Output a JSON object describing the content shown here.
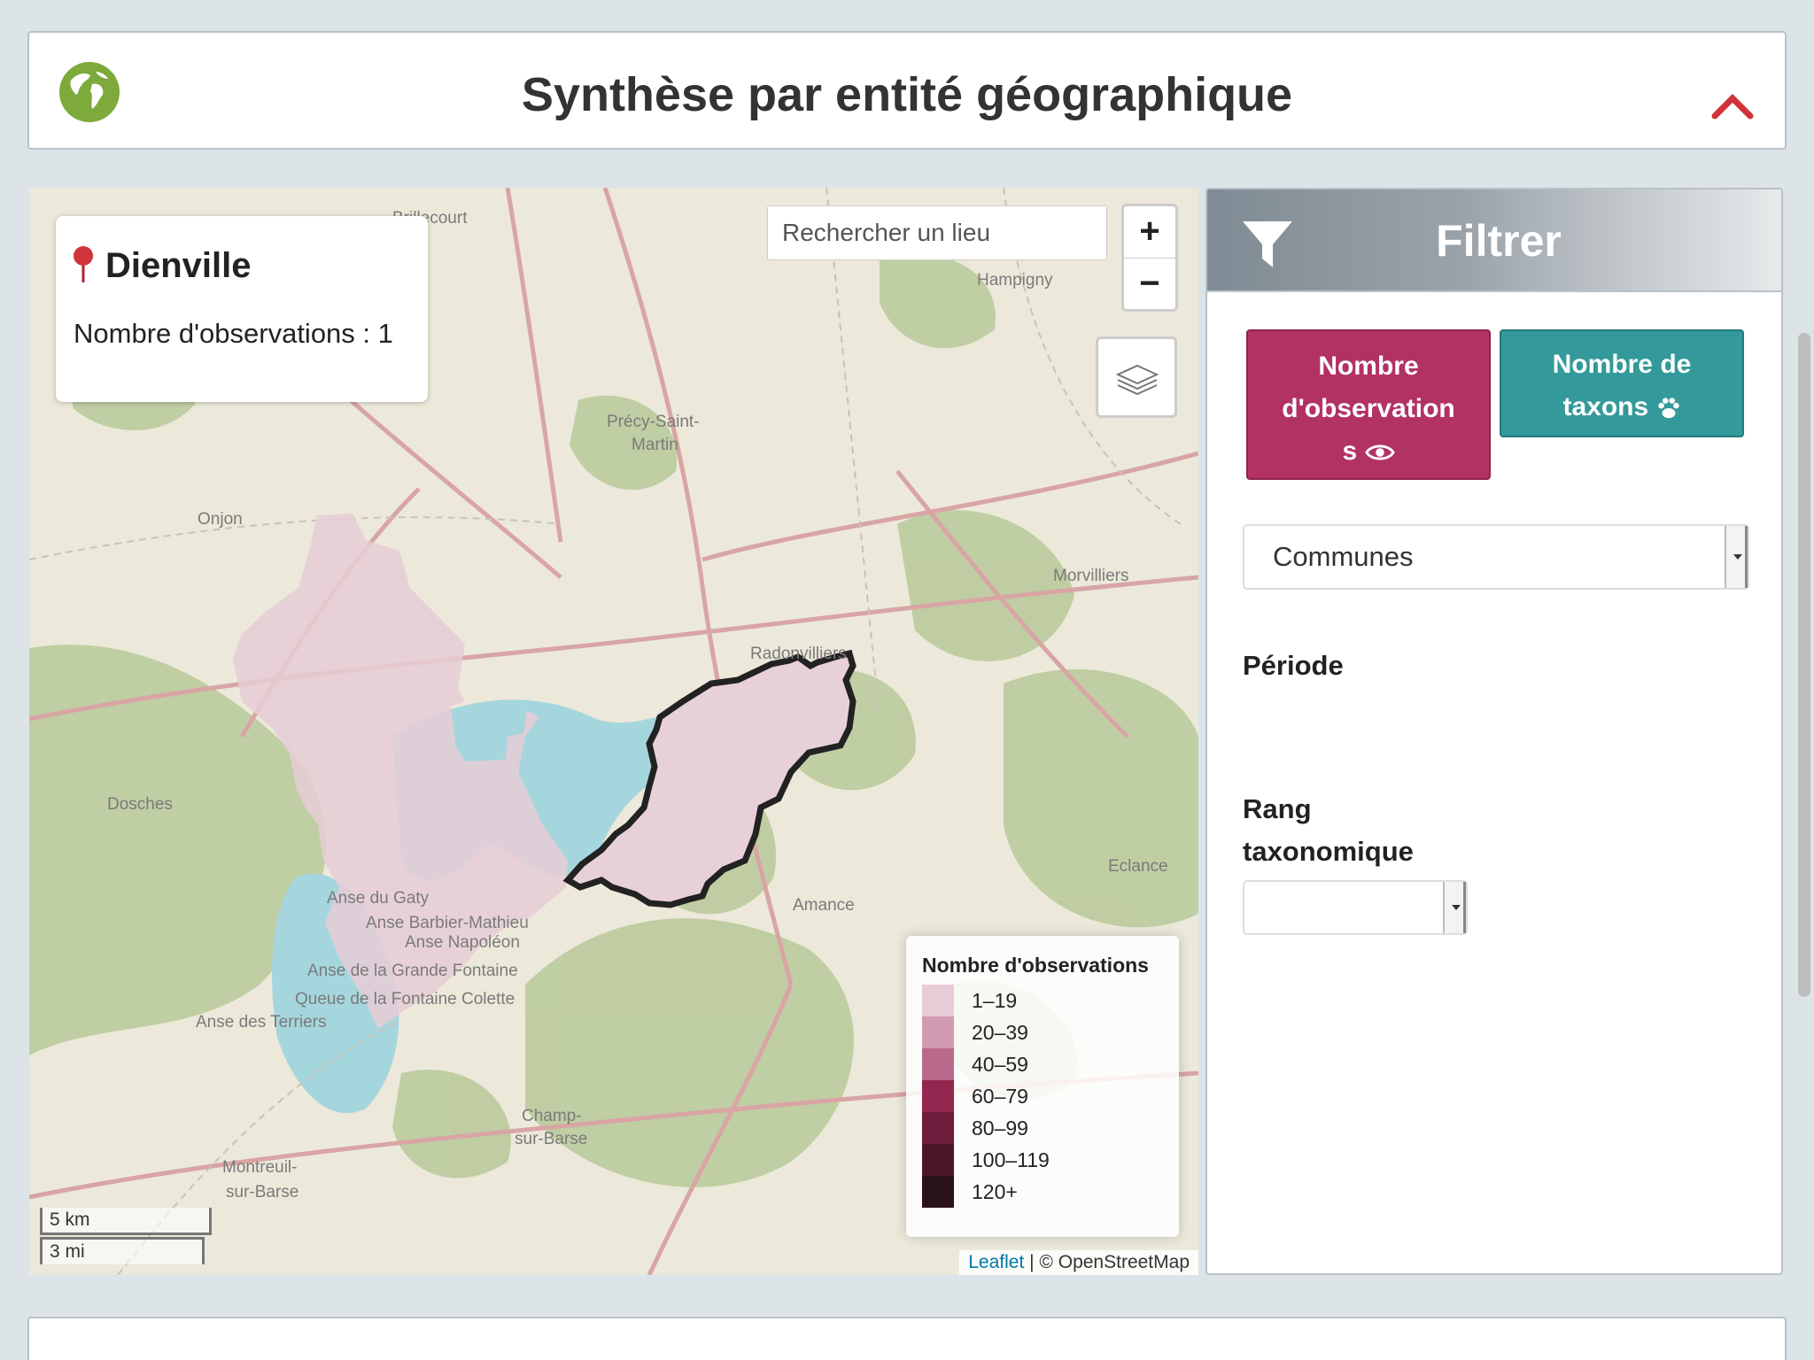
{
  "header": {
    "title": "Synthèse par entité géographique",
    "icon": "globe-icon",
    "collapse_icon": "chevron-up-icon",
    "accent_color": "#d0343a"
  },
  "map": {
    "info": {
      "commune": "Dienville",
      "observations": "Nombre d'observations : 1"
    },
    "search_placeholder": "Rechercher un lieu",
    "zoom_in": "+",
    "zoom_out": "−",
    "place_labels": [
      "Brillecourt",
      "Hampigny",
      "Précy-Saint-",
      "Martin",
      "Onjon",
      "Morvilliers",
      "Radonvilliers",
      "Dosches",
      "Eclance",
      "Amance",
      "Anse du Gaty",
      "Anse Barbier-Mathieu",
      "Anse Napoléon",
      "Anse de la Grande Fontaine",
      "Queue de la Fontaine Colette",
      "Anse des Terriers",
      "Champ-",
      "sur-Barse",
      "Montreuil-",
      "sur-Barse"
    ],
    "legend": {
      "title": "Nombre d'observations",
      "items": [
        {
          "label": "1–19",
          "color": "#e6ccd6"
        },
        {
          "label": "20–39",
          "color": "#d29ab1"
        },
        {
          "label": "40–59",
          "color": "#b96a8a"
        },
        {
          "label": "60–79",
          "color": "#93274f"
        },
        {
          "label": "80–99",
          "color": "#6e1d3c"
        },
        {
          "label": "100–119",
          "color": "#4a1729"
        },
        {
          "label": "120+",
          "color": "#2a1219"
        }
      ]
    },
    "scale": {
      "km": "5 km",
      "mi": "3 mi"
    },
    "attribution": {
      "link": "Leaflet",
      "text": " | © OpenStreetMap"
    }
  },
  "filter": {
    "title": "Filtrer",
    "btn_observations": {
      "line1": "Nombre",
      "line2": "d'observation",
      "line3": "s",
      "icon": "eye-icon",
      "color": "#b23264"
    },
    "btn_taxons": {
      "line1": "Nombre de",
      "line2": "taxons",
      "icon": "paw-icon",
      "color": "#33999a"
    },
    "select_entity": "Communes",
    "label_periode": "Période",
    "label_rang": "Rang taxonomique",
    "select_rang": ""
  }
}
